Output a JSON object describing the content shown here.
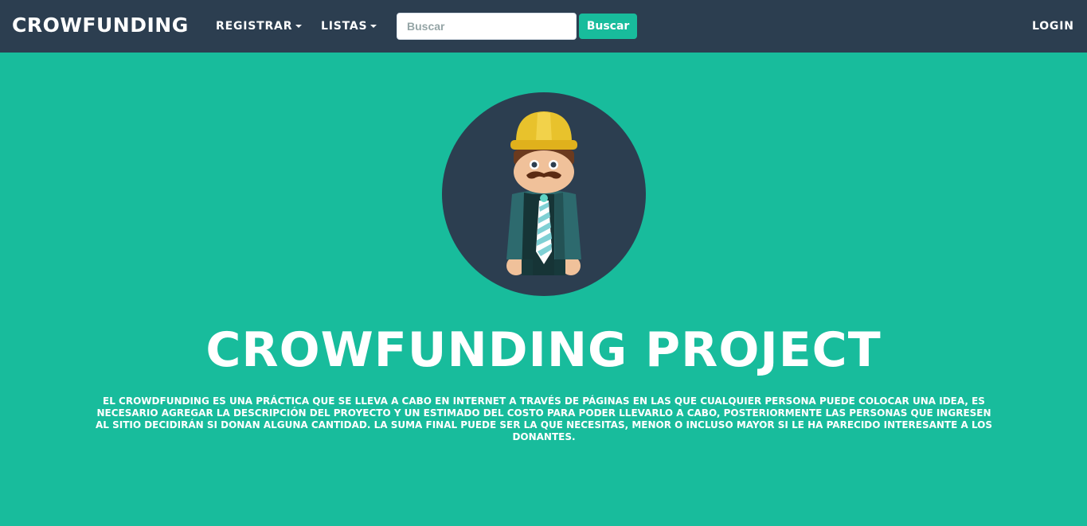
{
  "navbar": {
    "brand": "CROWFUNDING",
    "menu": [
      {
        "label": "REGISTRAR",
        "has_dropdown": true
      },
      {
        "label": "LISTAS",
        "has_dropdown": true
      }
    ],
    "search": {
      "placeholder": "Buscar",
      "value": "",
      "button_label": "Buscar"
    },
    "login_label": "LOGIN"
  },
  "hero": {
    "avatar_icon": "construction-worker-avatar-icon",
    "title": "CROWFUNDING PROJECT",
    "description": "EL CROWDFUNDING ES UNA PRÁCTICA QUE SE LLEVA A CABO EN INTERNET A TRAVÉS DE PÁGINAS EN LAS QUE CUALQUIER PERSONA PUEDE COLOCAR UNA IDEA, ES NECESARIO AGREGAR LA DESCRIPCIÓN DEL PROYECTO Y UN ESTIMADO DEL COSTO PARA PODER LLEVARLO A CABO, POSTERIORMENTE LAS PERSONAS QUE INGRESEN AL SITIO DECIDIRÁN SI DONAN ALGUNA CANTIDAD. LA SUMA FINAL PUEDE SER LA QUE NECESITAS, MENOR O INCLUSO MAYOR SI LE HA PARECIDO INTERESANTE A LOS DONANTES."
  },
  "colors": {
    "navbar_bg": "#2c3e50",
    "page_bg": "#18bc9c",
    "accent": "#18bc9c"
  }
}
